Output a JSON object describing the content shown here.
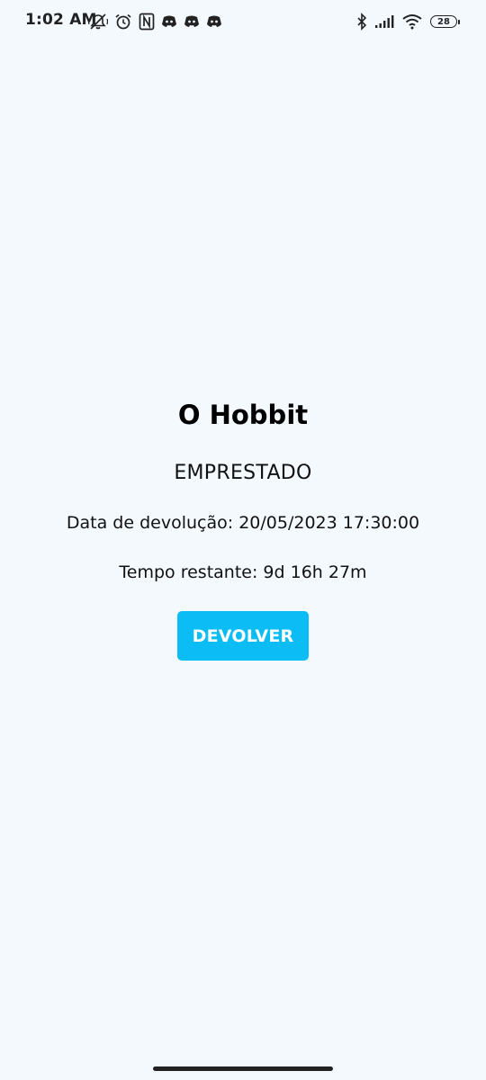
{
  "status_bar": {
    "time": "1:02 AM",
    "battery": "28",
    "left_icons": [
      "mute-icon",
      "alarm-icon",
      "nfc-icon",
      "discord-icon",
      "discord-icon",
      "discord-icon"
    ],
    "right_icons": [
      "bluetooth-icon",
      "signal-icon",
      "wifi-icon",
      "battery-icon"
    ]
  },
  "book": {
    "title": "O Hobbit",
    "status": "EMPRESTADO",
    "due_date_line": "Data de devolução: 20/05/2023 17:30:00",
    "remaining_line": "Tempo restante: 9d 16h 27m"
  },
  "actions": {
    "return_label": "DEVOLVER"
  },
  "colors": {
    "background": "#f4f9fe",
    "button": "#0bbdf4",
    "button_text": "#ffffff"
  }
}
